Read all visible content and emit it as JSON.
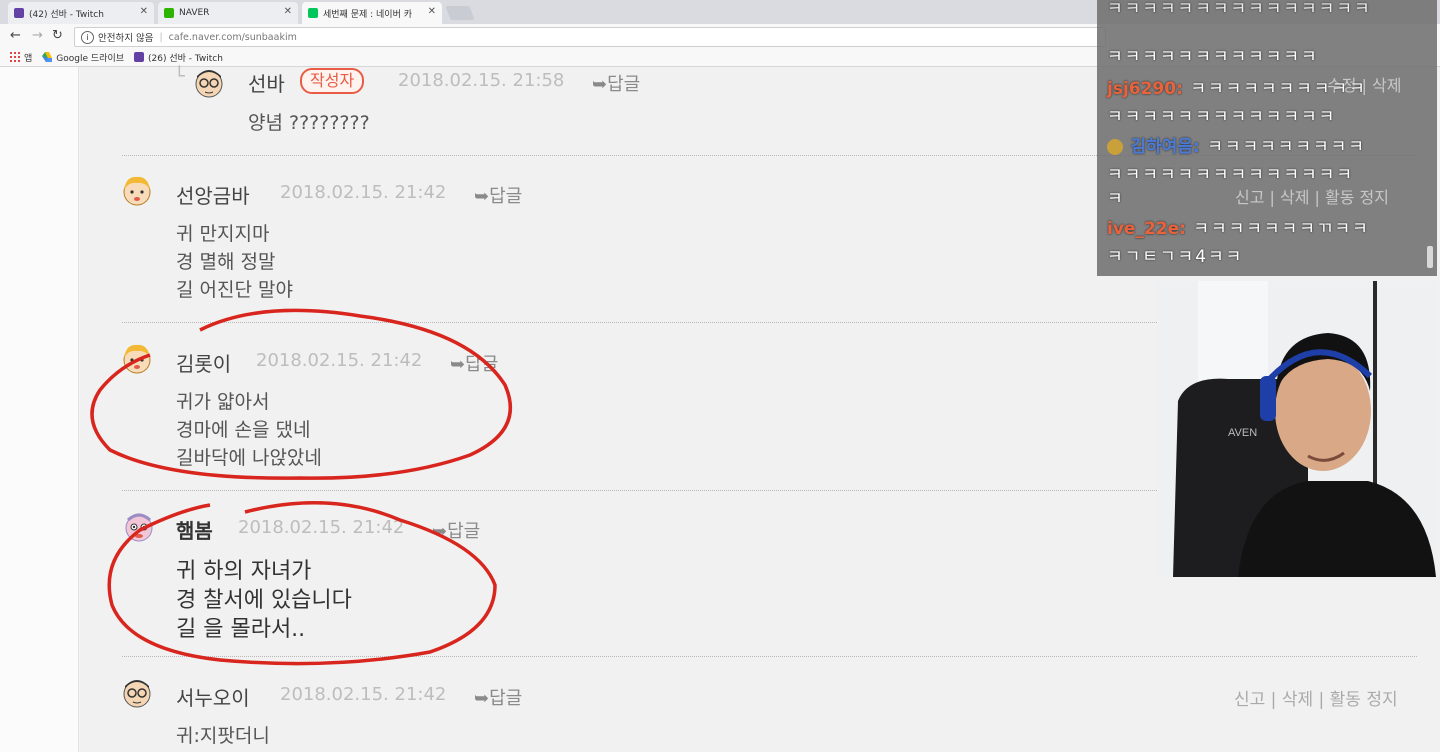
{
  "browser": {
    "tabs": [
      {
        "title": "(42) 선바 - Twitch",
        "icon_color": "#6441a5"
      },
      {
        "title": "NAVER",
        "icon_color": "#2db400"
      },
      {
        "title": "세번째 문제 : 네이버 카",
        "icon_color": "#03c75a"
      }
    ],
    "security_label": "안전하지 않음",
    "url": "cafe.naver.com/sunbaakim",
    "bookmarks": [
      {
        "label": "앱",
        "icon": "apps-grid-icon"
      },
      {
        "label": "Google 드라이브",
        "icon": "google-drive-icon"
      },
      {
        "label": "(26) 선바 - Twitch",
        "icon": "twitch-icon"
      }
    ]
  },
  "comments": [
    {
      "author": "선바",
      "badge": "작성자",
      "date": "2018.02.15. 21:58",
      "reply": "답글",
      "lines": [
        "양념 ????????"
      ],
      "actions": ""
    },
    {
      "author": "선앙금바",
      "date": "2018.02.15. 21:42",
      "reply": "답글",
      "lines": [
        "귀 만지지마",
        "경 멸해 정말",
        "길 어진단 말야"
      ],
      "actions": ""
    },
    {
      "author": "김롯이",
      "date": "2018.02.15. 21:42",
      "reply": "답글",
      "lines": [
        "귀가 얇아서",
        "경마에 손을 댔네",
        "길바닥에 나앉았네"
      ],
      "actions": ""
    },
    {
      "author": "햄봄",
      "date": "2018.02.15. 21:42",
      "reply": "답글",
      "lines": [
        "귀 하의 자녀가",
        "경 찰서에 있습니다",
        "길 을 몰라서.."
      ],
      "actions": ""
    },
    {
      "author": "서누오이",
      "date": "2018.02.15. 21:42",
      "reply": "답글",
      "lines": [
        "귀:지팟더니"
      ],
      "actions": "신고 | 삭제 | 활동 정지"
    }
  ],
  "chat": {
    "lines": [
      {
        "user": "",
        "text": "ㅋㅋㅋㅋㅋㅋㅋㅋㅋㅋㅋㅋㅋㅋㅋ"
      },
      {
        "user": "",
        "text": "ㅋㅋㅋㅋㅋㅋㅋㅋㅋㅋㅋㅋ"
      },
      {
        "user": "jsj6290",
        "text": "ㅋㅋㅋㅋㅋㅋㅋㅋㅋㅋ"
      },
      {
        "user": "",
        "text": "ㅋㅋㅋㅋㅋㅋㅋㅋㅋㅋㅋㅋㅋ"
      },
      {
        "user": "김하여음",
        "text": "ㅋㅋㅋㅋㅋㅋㅋㅋㅋ"
      },
      {
        "user": "",
        "text": "ㅋㅋㅋㅋㅋㅋㅋㅋㅋㅋㅋㅋㅋㅋ"
      },
      {
        "user": "",
        "text": "ㅋ"
      },
      {
        "user": "ive_22e",
        "text": "ㅋㅋㅋㅋㅋㅋㅋㄲㅋㅋ"
      },
      {
        "user": "",
        "text": "ㅋㄱㅌㄱㅋ4ㅋㅋ"
      }
    ],
    "user_colors": {
      "jsj6290": "#e8633b",
      "김하여음": "#4a7bd8",
      "ive_22e": "#e8633b"
    },
    "ghost_actions": "신고 | 삭제 | 활동 정지",
    "ghost_edit": "수정 | 삭제"
  },
  "annotation_color": "#d8251d"
}
